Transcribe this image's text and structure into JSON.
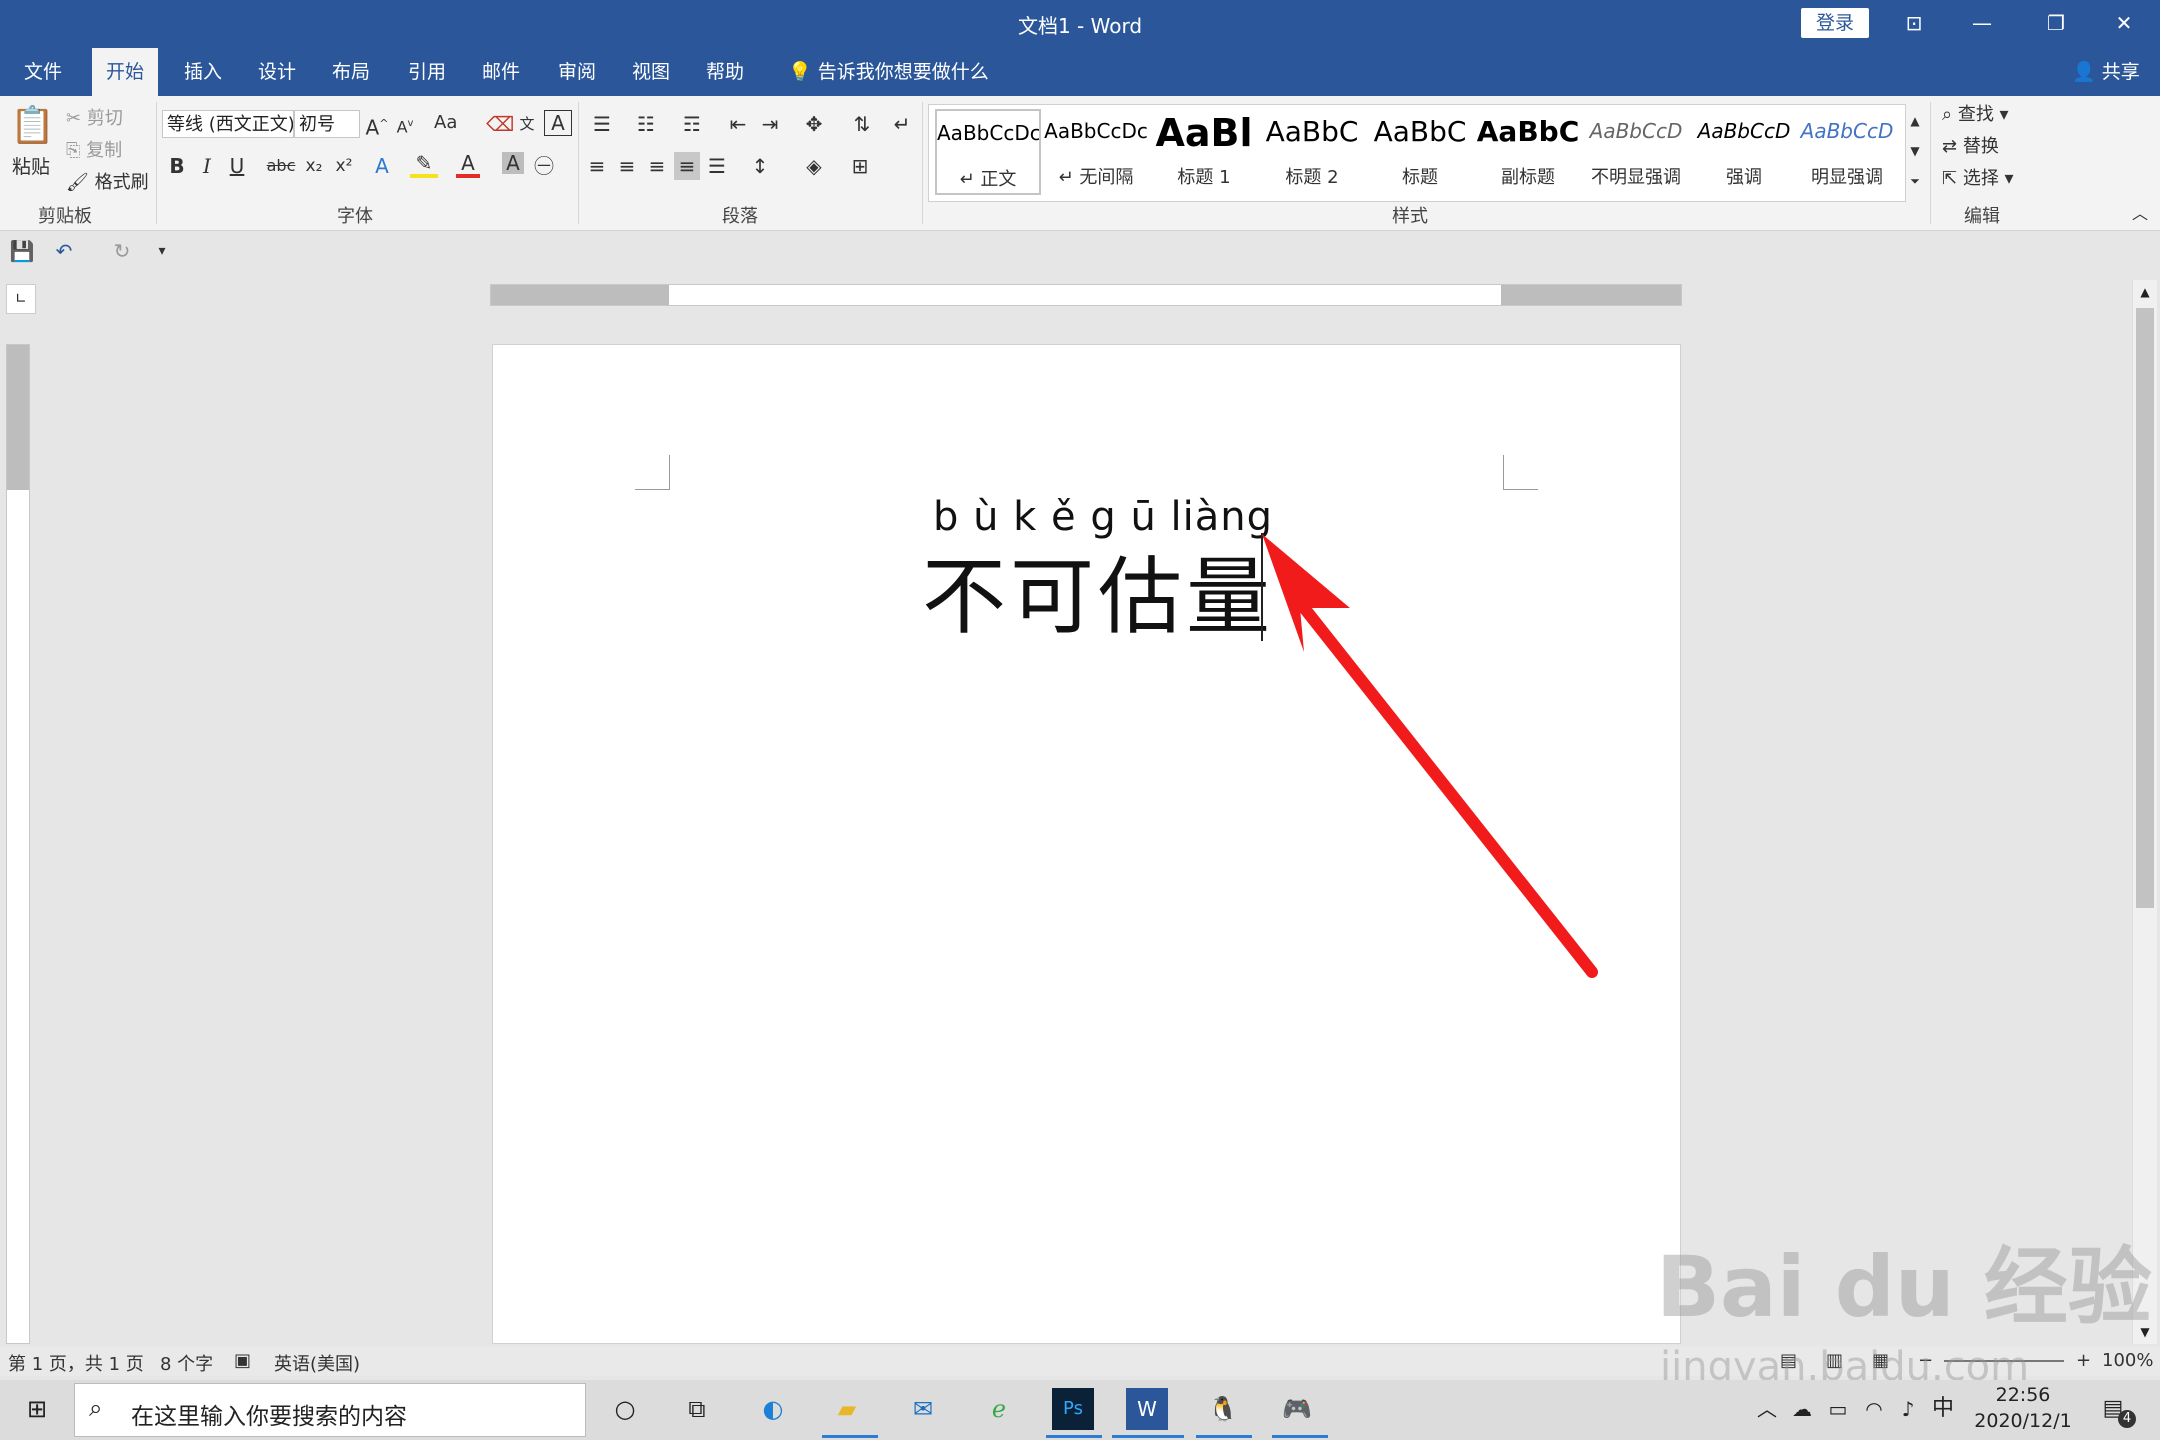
{
  "window": {
    "title": "文档1  -  Word",
    "login": "登录"
  },
  "tabs": [
    "文件",
    "开始",
    "插入",
    "设计",
    "布局",
    "引用",
    "邮件",
    "审阅",
    "视图",
    "帮助"
  ],
  "tell_me": "告诉我你想要做什么",
  "share": "共享",
  "clipboard": {
    "paste": "粘贴",
    "cut": "剪切",
    "copy": "复制",
    "format_painter": "格式刷",
    "group": "剪贴板"
  },
  "font": {
    "name": "等线 (西文正文)",
    "size": "初号",
    "case_label": "Aa",
    "group": "字体"
  },
  "paragraph": {
    "group": "段落"
  },
  "styles": {
    "group": "样式",
    "items": [
      {
        "sample": "AaBbCcDc",
        "name": "↵ 正文"
      },
      {
        "sample": "AaBbCcDc",
        "name": "↵ 无间隔"
      },
      {
        "sample": "AaBl",
        "name": "标题 1"
      },
      {
        "sample": "AaBbC",
        "name": "标题 2"
      },
      {
        "sample": "AaBbC",
        "name": "标题"
      },
      {
        "sample": "AaBbC",
        "name": "副标题"
      },
      {
        "sample": "AaBbCcD",
        "name": "不明显强调"
      },
      {
        "sample": "AaBbCcD",
        "name": "强调"
      },
      {
        "sample": "AaBbCcD",
        "name": "明显强调"
      }
    ]
  },
  "editing": {
    "find": "查找",
    "replace": "替换",
    "select": "选择",
    "group": "编辑"
  },
  "document": {
    "pinyin": "b ù k ě g ū liàng",
    "text": "不可估量"
  },
  "statusbar": {
    "page": "第 1 页，共 1 页",
    "words": "8 个字",
    "language": "英语(美国)",
    "zoom": "100%"
  },
  "taskbar": {
    "search_placeholder": "在这里输入你要搜索的内容",
    "time": "22:56",
    "date": "2020/12/1",
    "ime": "中",
    "notifications": "4"
  },
  "watermark": {
    "brand": "Bai du 经验",
    "url": "jingyan.baidu.com"
  }
}
